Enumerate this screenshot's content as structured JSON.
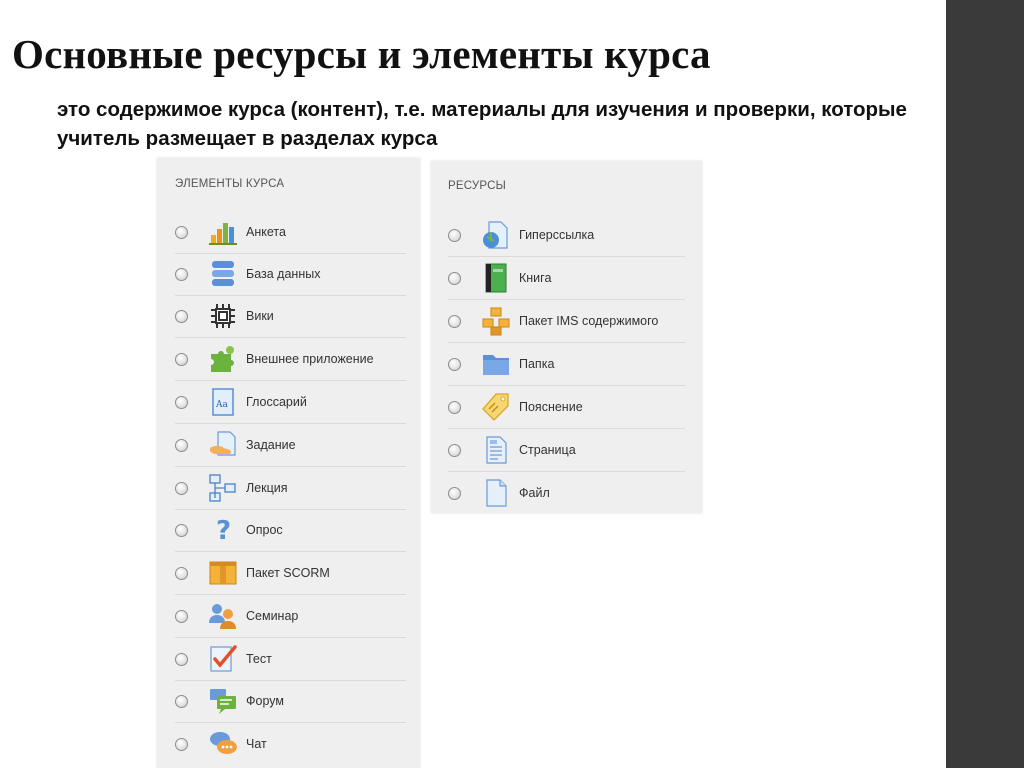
{
  "slide": {
    "title": "Основные ресурсы и элементы курса",
    "subtitle": "это содержимое курса (контент), т.е. материалы для изучения и проверки, которые учитель размещает в разделах курса"
  },
  "activities": {
    "header": "ЭЛЕМЕНТЫ КУРСА",
    "items": [
      {
        "label": "Анкета",
        "icon": "bar-chart-icon"
      },
      {
        "label": "База данных",
        "icon": "database-icon"
      },
      {
        "label": "Вики",
        "icon": "wiki-icon"
      },
      {
        "label": "Внешнее приложение",
        "icon": "puzzle-icon"
      },
      {
        "label": "Глоссарий",
        "icon": "glossary-icon"
      },
      {
        "label": "Задание",
        "icon": "assignment-icon"
      },
      {
        "label": "Лекция",
        "icon": "lesson-icon"
      },
      {
        "label": "Опрос",
        "icon": "question-icon"
      },
      {
        "label": "Пакет SCORM",
        "icon": "scorm-package-icon"
      },
      {
        "label": "Семинар",
        "icon": "workshop-icon"
      },
      {
        "label": "Тест",
        "icon": "quiz-check-icon"
      },
      {
        "label": "Форум",
        "icon": "forum-icon"
      },
      {
        "label": "Чат",
        "icon": "chat-icon"
      }
    ]
  },
  "resources": {
    "header": "РЕСУРСЫ",
    "items": [
      {
        "label": "Гиперссылка",
        "icon": "url-icon"
      },
      {
        "label": "Книга",
        "icon": "book-icon"
      },
      {
        "label": "Пакет IMS содержимого",
        "icon": "ims-package-icon"
      },
      {
        "label": "Папка",
        "icon": "folder-icon"
      },
      {
        "label": "Пояснение",
        "icon": "label-tag-icon"
      },
      {
        "label": "Страница",
        "icon": "page-icon"
      },
      {
        "label": "Файл",
        "icon": "file-icon"
      }
    ]
  },
  "colors": {
    "side_bar": "#3a3a3a",
    "panel_bg": "#efefef",
    "text": "#333333"
  }
}
